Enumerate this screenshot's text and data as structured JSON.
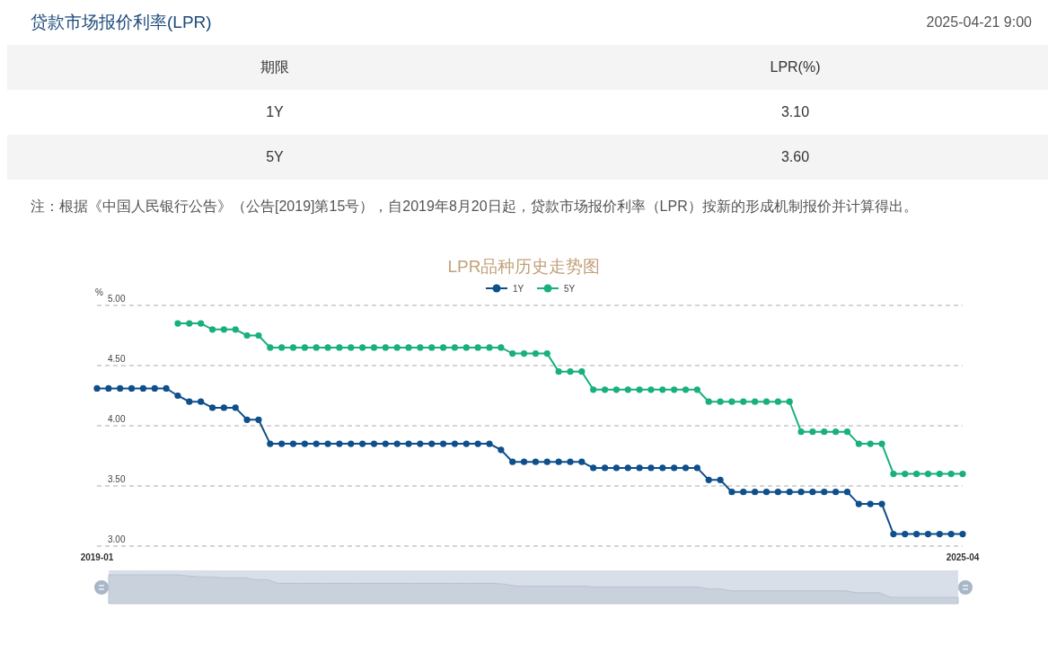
{
  "header": {
    "title": "贷款市场报价利率(LPR)",
    "datetime": "2025-04-21 9:00"
  },
  "table": {
    "columns": [
      "期限",
      "LPR(%)"
    ],
    "rows": [
      [
        "1Y",
        "3.10"
      ],
      [
        "5Y",
        "3.60"
      ]
    ]
  },
  "note": "注：根据《中国人民银行公告》（公告[2019]第15号），自2019年8月20日起，贷款市场报价利率（LPR）按新的形成机制报价并计算得出。",
  "chart": {
    "chart_data": {
      "type": "line",
      "title": "LPR品种历史走势图",
      "ylabel": "%",
      "categories": [
        "2019-01",
        null,
        null,
        null,
        null,
        null,
        null,
        null,
        null,
        null,
        null,
        null,
        null,
        null,
        null,
        null,
        null,
        null,
        null,
        null,
        null,
        null,
        null,
        null,
        null,
        null,
        null,
        null,
        null,
        null,
        null,
        null,
        null,
        null,
        null,
        null,
        null,
        null,
        null,
        null,
        null,
        null,
        null,
        null,
        null,
        null,
        null,
        null,
        null,
        null,
        null,
        null,
        null,
        null,
        null,
        null,
        null,
        null,
        null,
        null,
        null,
        null,
        null,
        null,
        null,
        null,
        null,
        null,
        null,
        null,
        null,
        null,
        null,
        null,
        null,
        "2025-04"
      ],
      "grid": true,
      "legend": "top",
      "series": [
        {
          "name": "1Y",
          "color": "#0e4f8c",
          "marker": "circle",
          "values": [
            4.31,
            4.31,
            4.31,
            4.31,
            4.31,
            4.31,
            4.31,
            4.25,
            4.2,
            4.2,
            4.15,
            4.15,
            4.15,
            4.05,
            4.05,
            3.85,
            3.85,
            3.85,
            3.85,
            3.85,
            3.85,
            3.85,
            3.85,
            3.85,
            3.85,
            3.85,
            3.85,
            3.85,
            3.85,
            3.85,
            3.85,
            3.85,
            3.85,
            3.85,
            3.85,
            3.8,
            3.7,
            3.7,
            3.7,
            3.7,
            3.7,
            3.7,
            3.7,
            3.65,
            3.65,
            3.65,
            3.65,
            3.65,
            3.65,
            3.65,
            3.65,
            3.65,
            3.65,
            3.55,
            3.55,
            3.45,
            3.45,
            3.45,
            3.45,
            3.45,
            3.45,
            3.45,
            3.45,
            3.45,
            3.45,
            3.45,
            3.35,
            3.35,
            3.35,
            3.1,
            3.1,
            3.1,
            3.1,
            3.1,
            3.1,
            3.1
          ]
        },
        {
          "name": "5Y",
          "color": "#18b07c",
          "marker": "circle",
          "values": [
            null,
            null,
            null,
            null,
            null,
            null,
            null,
            4.85,
            4.85,
            4.85,
            4.8,
            4.8,
            4.8,
            4.75,
            4.75,
            4.65,
            4.65,
            4.65,
            4.65,
            4.65,
            4.65,
            4.65,
            4.65,
            4.65,
            4.65,
            4.65,
            4.65,
            4.65,
            4.65,
            4.65,
            4.65,
            4.65,
            4.65,
            4.65,
            4.65,
            4.65,
            4.6,
            4.6,
            4.6,
            4.6,
            4.45,
            4.45,
            4.45,
            4.3,
            4.3,
            4.3,
            4.3,
            4.3,
            4.3,
            4.3,
            4.3,
            4.3,
            4.3,
            4.2,
            4.2,
            4.2,
            4.2,
            4.2,
            4.2,
            4.2,
            4.2,
            3.95,
            3.95,
            3.95,
            3.95,
            3.95,
            3.85,
            3.85,
            3.85,
            3.6,
            3.6,
            3.6,
            3.6,
            3.6,
            3.6,
            3.6
          ]
        }
      ],
      "ylim": [
        3,
        5
      ],
      "yticks": [
        {
          "value": 3,
          "label": "3.00"
        },
        {
          "value": 3.5,
          "label": "3.50"
        },
        {
          "value": 4,
          "label": "4.00"
        },
        {
          "value": 4.5,
          "label": "4.50"
        },
        {
          "value": 5,
          "label": "5.00"
        }
      ]
    }
  }
}
